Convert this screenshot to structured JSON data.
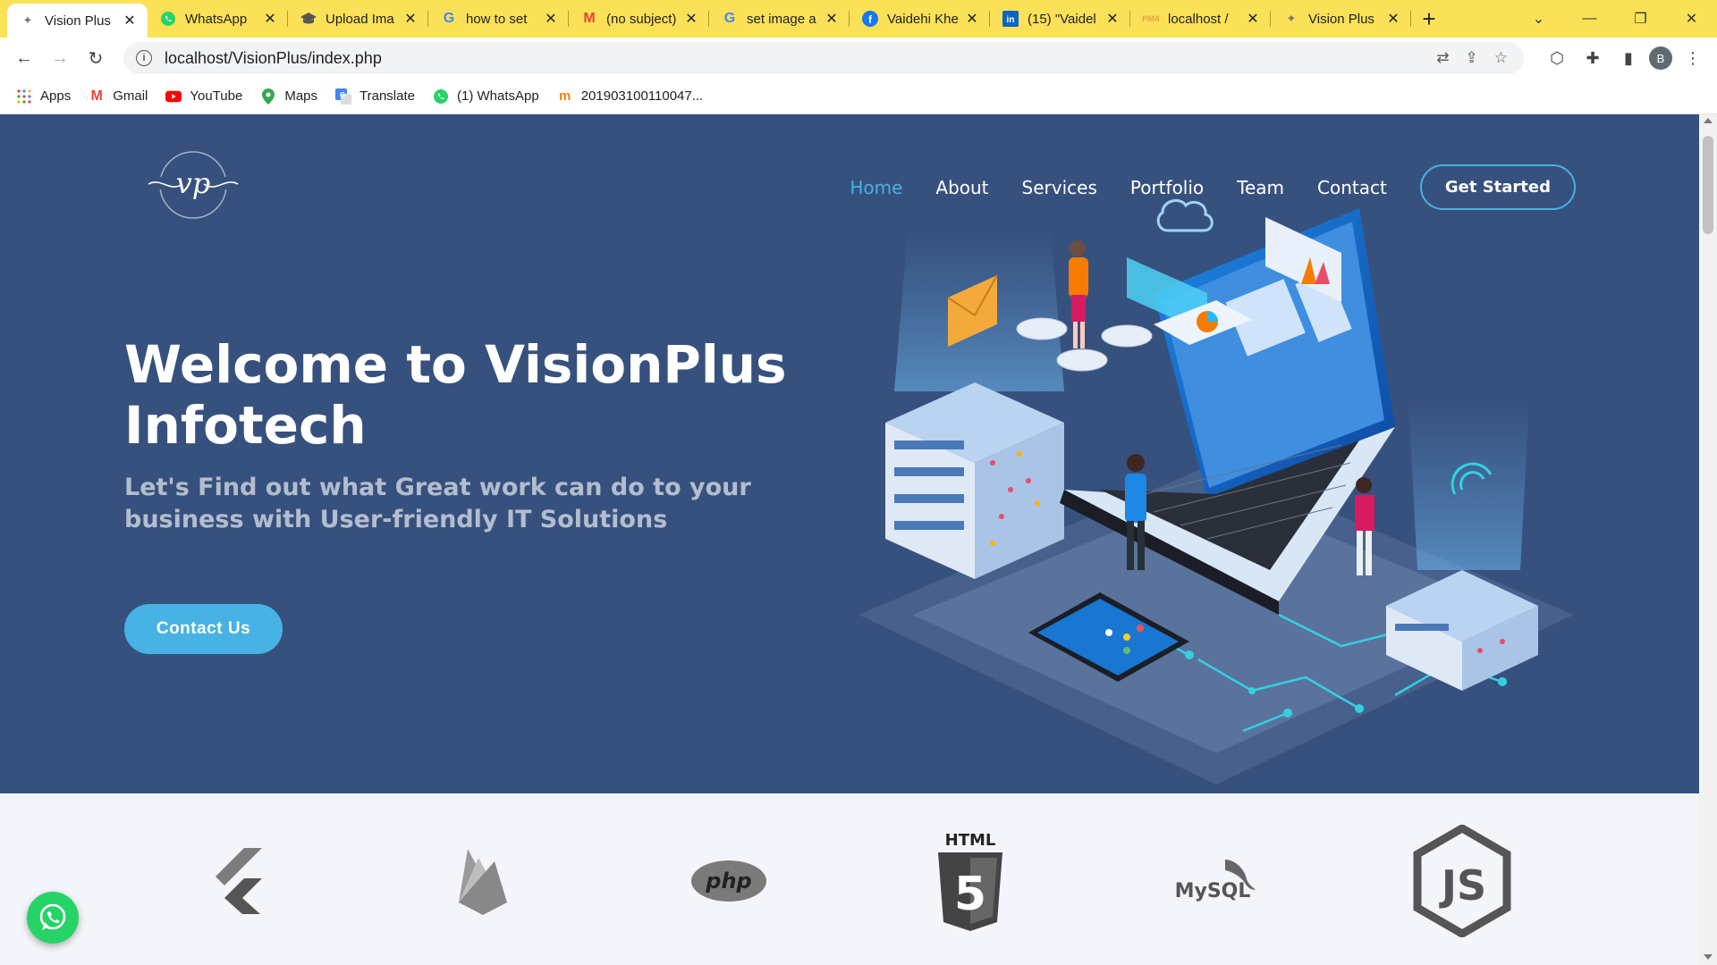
{
  "browser": {
    "tabs": [
      {
        "title": "Vision Plus",
        "icon": "vp-favicon",
        "active": true
      },
      {
        "title": "WhatsApp",
        "icon": "whatsapp-icon"
      },
      {
        "title": "Upload Ima",
        "icon": "upload-icon"
      },
      {
        "title": "how to set",
        "icon": "google-icon"
      },
      {
        "title": "(no subject)",
        "icon": "gmail-icon"
      },
      {
        "title": "set image a",
        "icon": "google-icon"
      },
      {
        "title": "Vaidehi Khe",
        "icon": "facebook-icon"
      },
      {
        "title": "(15) \"Vaidel",
        "icon": "linkedin-icon"
      },
      {
        "title": "localhost /",
        "icon": "phpmyadmin-icon"
      },
      {
        "title": "Vision Plus",
        "icon": "vp-favicon"
      }
    ],
    "new_tab": "+",
    "url": "localhost/VisionPlus/index.php",
    "profile_initial": "B",
    "bookmarks": [
      {
        "label": "Apps",
        "icon": "apps-grid-icon"
      },
      {
        "label": "Gmail",
        "icon": "gmail-icon"
      },
      {
        "label": "YouTube",
        "icon": "youtube-icon"
      },
      {
        "label": "Maps",
        "icon": "maps-icon"
      },
      {
        "label": "Translate",
        "icon": "translate-icon"
      },
      {
        "label": "(1) WhatsApp",
        "icon": "whatsapp-icon"
      },
      {
        "label": "201903100110047...",
        "icon": "moodle-icon"
      }
    ]
  },
  "site": {
    "nav": [
      {
        "label": "Home",
        "active": true
      },
      {
        "label": "About"
      },
      {
        "label": "Services"
      },
      {
        "label": "Portfolio"
      },
      {
        "label": "Team"
      },
      {
        "label": "Contact"
      }
    ],
    "cta_label": "Get Started",
    "hero_title": "Welcome to VisionPlus Infotech",
    "hero_subtitle": "Let's Find out what Great work can do to your business with User-friendly IT Solutions",
    "contact_label": "Contact Us",
    "clients": [
      "flutter-logo",
      "firebase-logo",
      "php-logo",
      "html5-logo",
      "mysql-logo",
      "nodejs-logo"
    ],
    "client_texts": {
      "php": "php",
      "html": "HTML",
      "mysql": "MySQL",
      "js": "JS"
    },
    "colors": {
      "hero_bg": "#37517e",
      "accent": "#47b2e4",
      "tabstrip": "#fbe158",
      "clients_bg": "#f3f5fa"
    }
  }
}
